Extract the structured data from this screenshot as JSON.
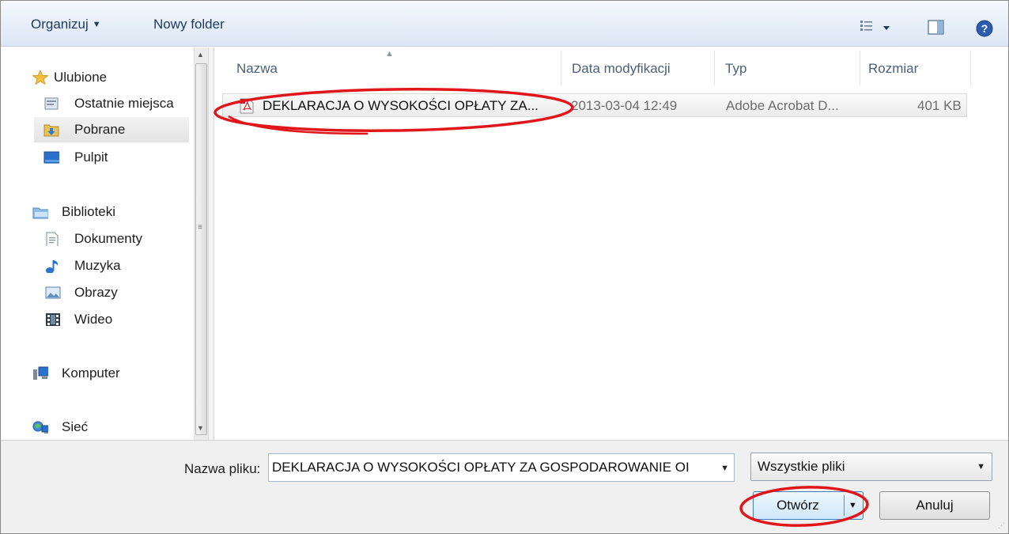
{
  "toolbar": {
    "organize_label": "Organizuj",
    "new_folder_label": "Nowy folder",
    "views_icon": "views-icon",
    "preview_icon": "preview-pane-icon",
    "help_icon": "help-icon"
  },
  "nav": {
    "favorites": {
      "label": "Ulubione",
      "icon": "star-icon"
    },
    "favorites_items": [
      {
        "label": "Ostatnie miejsca",
        "icon": "recent-places-icon"
      },
      {
        "label": "Pobrane",
        "icon": "downloads-icon",
        "selected": true
      },
      {
        "label": "Pulpit",
        "icon": "desktop-icon"
      }
    ],
    "libraries": {
      "label": "Biblioteki",
      "icon": "libraries-icon"
    },
    "libraries_items": [
      {
        "label": "Dokumenty",
        "icon": "documents-icon"
      },
      {
        "label": "Muzyka",
        "icon": "music-icon"
      },
      {
        "label": "Obrazy",
        "icon": "pictures-icon"
      },
      {
        "label": "Wideo",
        "icon": "video-icon"
      }
    ],
    "computer": {
      "label": "Komputer",
      "icon": "computer-icon"
    },
    "network": {
      "label": "Sieć",
      "icon": "network-icon"
    }
  },
  "columns": {
    "name": "Nazwa",
    "date": "Data modyfikacji",
    "type": "Typ",
    "size": "Rozmiar"
  },
  "files": [
    {
      "name": "DEKLARACJA O WYSOKOŚCI OPŁATY ZA...",
      "date": "2013-03-04 12:49",
      "type": "Adobe Acrobat D...",
      "size": "401 KB",
      "icon": "pdf-file-icon"
    }
  ],
  "bottom": {
    "filename_label": "Nazwa pliku:",
    "filename_value": "DEKLARACJA O WYSOKOŚCI OPŁATY ZA GOSPODAROWANIE OI",
    "filter_value": "Wszystkie pliki",
    "open_label": "Otwórz",
    "cancel_label": "Anuluj"
  },
  "colors": {
    "annotation": "#e0161b",
    "selection": "#e8e8e8",
    "toolbar_text": "#1e3a5f"
  }
}
